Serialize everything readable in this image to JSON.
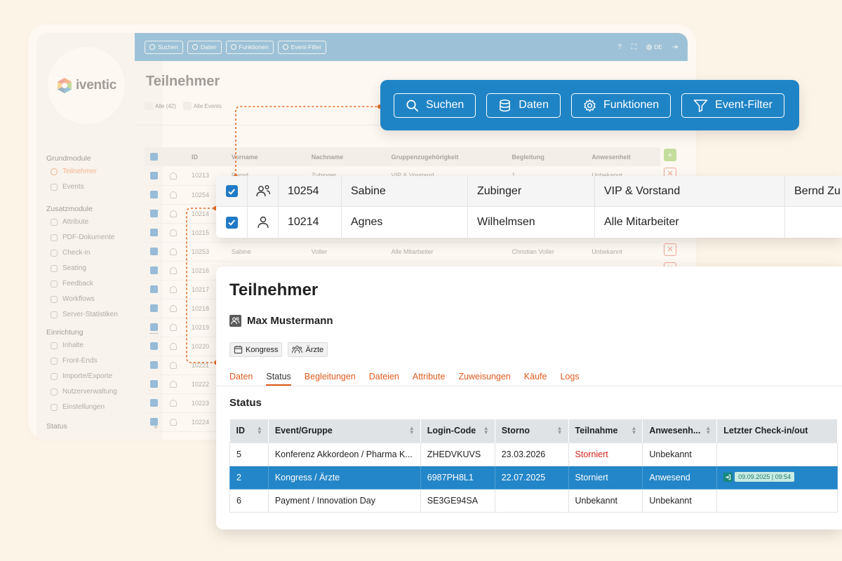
{
  "brand": {
    "name": "iventic",
    "logo_colors": [
      "#e56a25",
      "#7fc241",
      "#2a86c4",
      "#f2b233"
    ]
  },
  "sidebar": {
    "groups": [
      {
        "label": "Grundmodule",
        "toggle": "—",
        "items": [
          {
            "label": "Teilnehmer",
            "icon": "person-icon",
            "active": true
          },
          {
            "label": "Events",
            "icon": "calendar-icon"
          }
        ]
      },
      {
        "label": "Zusatzmodule",
        "toggle": "—",
        "items": [
          {
            "label": "Attribute",
            "icon": "tag-icon"
          },
          {
            "label": "PDF-Dokumente",
            "icon": "pdf-icon"
          },
          {
            "label": "Check-in",
            "icon": "checkin-icon"
          },
          {
            "label": "Seating",
            "icon": "seating-icon"
          },
          {
            "label": "Feedback",
            "icon": "feedback-icon"
          },
          {
            "label": "Workflows",
            "icon": "workflow-icon"
          },
          {
            "label": "Server-Statistiken",
            "icon": "stats-icon"
          }
        ]
      },
      {
        "label": "Einrichtung",
        "toggle": "—",
        "items": [
          {
            "label": "Inhalte",
            "icon": "content-icon"
          },
          {
            "label": "Front-Ends",
            "icon": "frontend-icon"
          },
          {
            "label": "Importe/Exporte",
            "icon": "import-export-icon"
          },
          {
            "label": "Nutzerverwaltung",
            "icon": "users-icon"
          },
          {
            "label": "Einstellungen",
            "icon": "settings-icon"
          }
        ]
      },
      {
        "label": "Status",
        "toggle": "+",
        "items": []
      }
    ]
  },
  "topbar": {
    "buttons": [
      {
        "label": "Suchen",
        "icon": "search-icon"
      },
      {
        "label": "Daten",
        "icon": "database-icon"
      },
      {
        "label": "Funktionen",
        "icon": "gear-icon"
      },
      {
        "label": "Event-Filter",
        "icon": "filter-icon"
      }
    ],
    "right": {
      "help": "?",
      "lang": "DE"
    }
  },
  "background_page": {
    "title": "Teilnehmer",
    "filters": [
      {
        "label": "Alle (42)"
      },
      {
        "label": "Alle Events"
      }
    ],
    "columns": [
      "ID",
      "Vorname",
      "Nachname",
      "Gruppenzugehörigkeit",
      "Begleitung",
      "Anwesenheit"
    ],
    "rows": [
      {
        "id": "10213",
        "first": "Bernd",
        "last": "Zubinger",
        "group": "VIP & Vorstand",
        "companion": "1",
        "presence": "Unbekannt"
      },
      {
        "id": "10254",
        "first": "",
        "last": "",
        "group": "",
        "companion": "",
        "presence": ""
      },
      {
        "id": "10214",
        "first": "",
        "last": "",
        "group": "",
        "companion": "",
        "presence": ""
      },
      {
        "id": "10215",
        "first": "",
        "last": "",
        "group": "",
        "companion": "",
        "presence": ""
      },
      {
        "id": "10253",
        "first": "Sabine",
        "last": "Voller",
        "group": "Alle Mitarbeiter",
        "companion": "Christian Voller",
        "presence": "Unbekannt"
      },
      {
        "id": "10216",
        "first": "",
        "last": "",
        "group": "",
        "companion": "",
        "presence": ""
      },
      {
        "id": "10217",
        "first": "",
        "last": "",
        "group": "",
        "companion": "",
        "presence": ""
      },
      {
        "id": "10218",
        "first": "",
        "last": "",
        "group": "",
        "companion": "",
        "presence": ""
      },
      {
        "id": "10219",
        "first": "",
        "last": "",
        "group": "",
        "companion": "",
        "presence": ""
      },
      {
        "id": "10220",
        "first": "",
        "last": "",
        "group": "",
        "companion": "",
        "presence": ""
      },
      {
        "id": "10221",
        "first": "",
        "last": "",
        "group": "",
        "companion": "",
        "presence": ""
      },
      {
        "id": "10222",
        "first": "",
        "last": "",
        "group": "",
        "companion": "",
        "presence": ""
      },
      {
        "id": "10223",
        "first": "",
        "last": "",
        "group": "",
        "companion": "",
        "presence": ""
      },
      {
        "id": "10224",
        "first": "",
        "last": "",
        "group": "",
        "companion": "",
        "presence": ""
      }
    ]
  },
  "toolbar_zoom": {
    "buttons": [
      {
        "label": "Suchen",
        "icon": "search-icon"
      },
      {
        "label": "Daten",
        "icon": "database-icon"
      },
      {
        "label": "Funktionen",
        "icon": "gear-icon"
      },
      {
        "label": "Event-Filter",
        "icon": "filter-icon"
      }
    ]
  },
  "rows_zoom": [
    {
      "id": "10254",
      "first": "Sabine",
      "last": "Zubinger",
      "group": "VIP & Vorstand",
      "companion": "Bernd Zu",
      "checked": true,
      "icon": "person-group-icon"
    },
    {
      "id": "10214",
      "first": "Agnes",
      "last": "Wilhelmsen",
      "group": "Alle Mitarbeiter",
      "companion": "",
      "checked": true,
      "icon": "person-icon"
    }
  ],
  "detail": {
    "title": "Teilnehmer",
    "person": "Max Mustermann",
    "chips": [
      {
        "label": "Kongress",
        "icon": "calendar-icon"
      },
      {
        "label": "Ärzte",
        "icon": "group-icon"
      }
    ],
    "tabs": [
      "Daten",
      "Status",
      "Begleitungen",
      "Dateien",
      "Attribute",
      "Zuweisungen",
      "Käufe",
      "Logs"
    ],
    "active_tab": "Status",
    "section_title": "Status",
    "columns": [
      "ID",
      "Event/Gruppe",
      "Login-Code",
      "Storno",
      "Teilnahme",
      "Anwesenh...",
      "Letzter Check-in/out"
    ],
    "rows": [
      {
        "id": "5",
        "event": "Konferenz Akkordeon / Pharma K...",
        "code": "ZHEDVKUVS",
        "storno": "23.03.2026",
        "participation": "Storniert",
        "presence": "Unbekannt",
        "checkin": "",
        "participation_color": "#d6231e"
      },
      {
        "id": "2",
        "event": "Kongress / Ärzte",
        "code": "6987PH8L1",
        "storno": "22.07.2025",
        "participation": "Storniert",
        "presence": "Anwesend",
        "checkin": "09.09.2025 | 09:54",
        "selected": true
      },
      {
        "id": "6",
        "event": "Payment / Innovation Day",
        "code": "SE3GE94SA",
        "storno": "",
        "participation": "Unbekannt",
        "presence": "Unbekannt",
        "checkin": ""
      }
    ]
  },
  "colors": {
    "accent": "#e56a25",
    "primary": "#1f84c6",
    "selected_row": "#2386c8",
    "danger": "#d6231e",
    "success": "#7fc241"
  }
}
